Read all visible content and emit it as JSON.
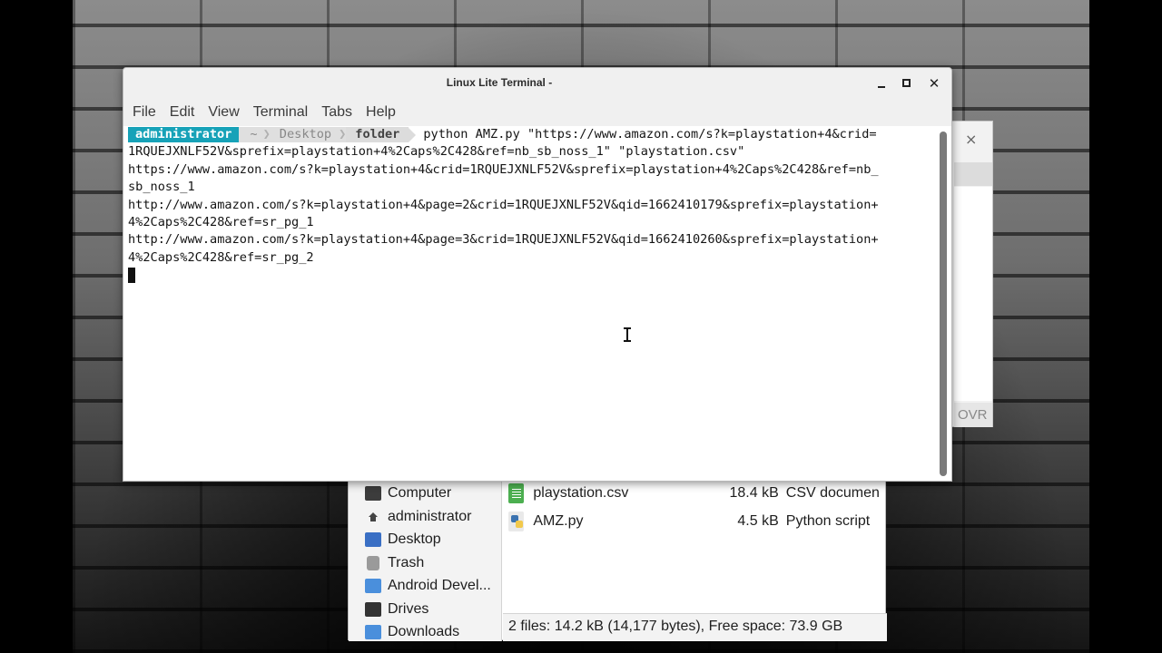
{
  "terminal": {
    "title": "Linux Lite Terminal -",
    "menu": [
      "File",
      "Edit",
      "View",
      "Terminal",
      "Tabs",
      "Help"
    ],
    "prompt": {
      "user": "administrator",
      "home": "~",
      "dir1": "Desktop",
      "dir2": "folder"
    },
    "command_line1": "python AMZ.py \"https://www.amazon.com/s?k=playstation+4&crid=",
    "lines": [
      "1RQUEJXNLF52V&sprefix=playstation+4%2Caps%2C428&ref=nb_sb_noss_1\" \"playstation.csv\"",
      "https://www.amazon.com/s?k=playstation+4&crid=1RQUEJXNLF52V&sprefix=playstation+4%2Caps%2C428&ref=nb_",
      "sb_noss_1",
      "http://www.amazon.com/s?k=playstation+4&page=2&crid=1RQUEJXNLF52V&qid=1662410179&sprefix=playstation+",
      "4%2Caps%2C428&ref=sr_pg_1",
      "http://www.amazon.com/s?k=playstation+4&page=3&crid=1RQUEJXNLF52V&qid=1662410260&sprefix=playstation+",
      "4%2Caps%2C428&ref=sr_pg_2"
    ]
  },
  "background_editor": {
    "close_label": "×",
    "status_mode": "OVR"
  },
  "file_manager": {
    "sidebar": [
      {
        "label": "Computer",
        "icon": "computer-icon"
      },
      {
        "label": "administrator",
        "icon": "home-icon"
      },
      {
        "label": "Desktop",
        "icon": "desktop-icon"
      },
      {
        "label": "Trash",
        "icon": "trash-icon"
      },
      {
        "label": "Android Devel...",
        "icon": "folder-icon"
      },
      {
        "label": "Drives",
        "icon": "drive-icon"
      },
      {
        "label": "Downloads",
        "icon": "folder-icon"
      }
    ],
    "files": [
      {
        "name": "playstation.csv",
        "size": "18.4 kB",
        "type": "CSV documen",
        "icon": "spreadsheet-icon"
      },
      {
        "name": "AMZ.py",
        "size": "4.5 kB",
        "type": "Python script",
        "icon": "python-icon"
      }
    ],
    "status": "2 files: 14.2 kB (14,177 bytes), Free space: 73.9 GB"
  }
}
